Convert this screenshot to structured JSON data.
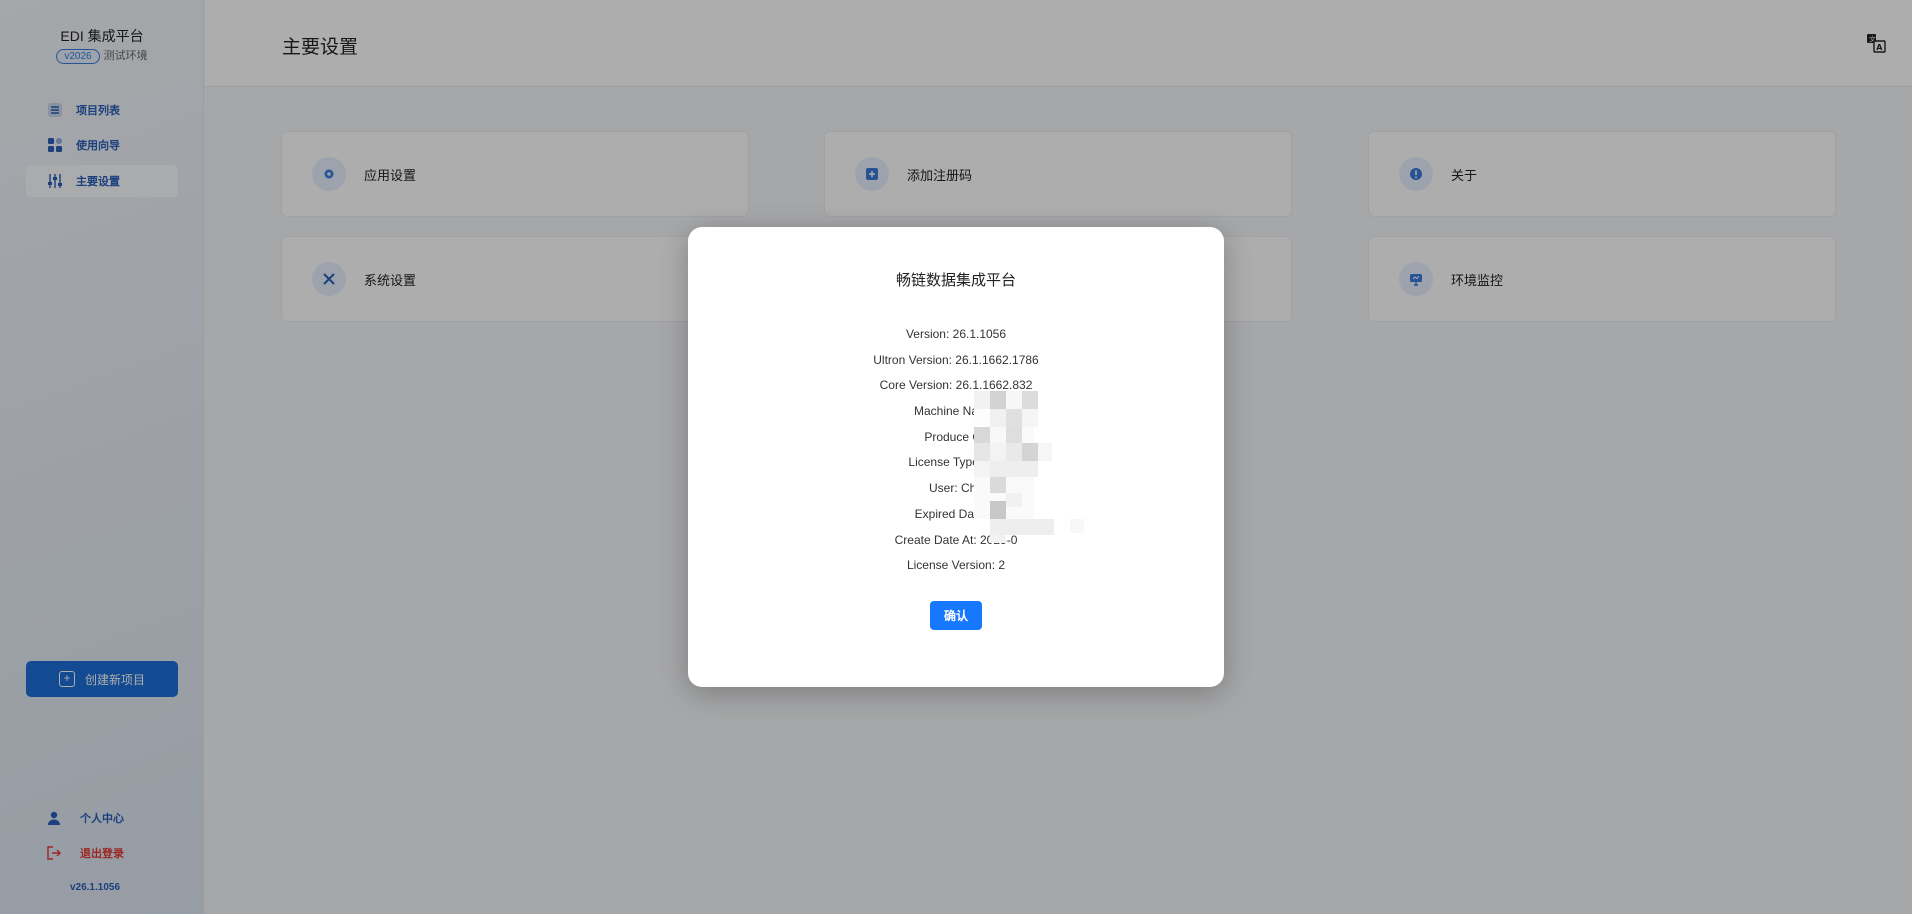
{
  "app": {
    "title": "EDI 集成平台",
    "version_badge": "v2026",
    "env_label": "测试环境"
  },
  "sidebar": {
    "items": [
      {
        "label": "项目列表",
        "icon": "project-list-icon"
      },
      {
        "label": "使用向导",
        "icon": "guide-grid-icon"
      },
      {
        "label": "主要设置",
        "icon": "settings-sliders-icon",
        "active": true
      }
    ],
    "create_button": "创建新项目",
    "profile": "个人中心",
    "logout": "退出登录",
    "footer_version": "v26.1.1056"
  },
  "header": {
    "title": "主要设置"
  },
  "cards": [
    {
      "label": "应用设置",
      "icon": "gear-icon"
    },
    {
      "label": "添加注册码",
      "icon": "add-icon"
    },
    {
      "label": "关于",
      "icon": "info-icon"
    },
    {
      "label": "系统设置",
      "icon": "tools-icon"
    },
    {
      "label": "",
      "icon": ""
    },
    {
      "label": "环境监控",
      "icon": "monitor-icon"
    }
  ],
  "modal": {
    "title": "畅链数据集成平台",
    "lines": [
      "Version: 26.1.1056",
      "Ultron Version: 26.1.1662.1786",
      "Core Version: 26.1.1662.832",
      "Machine Name:",
      "Produce Co",
      "License Type: For",
      "User: Chir",
      "Expired Date: 2",
      "Create Date At: 2025-0",
      "License Version: 2"
    ],
    "confirm": "确认"
  },
  "colors": {
    "primary": "#1677ff",
    "sidebar_accent": "#2a5fb8",
    "logout": "#e53935"
  }
}
